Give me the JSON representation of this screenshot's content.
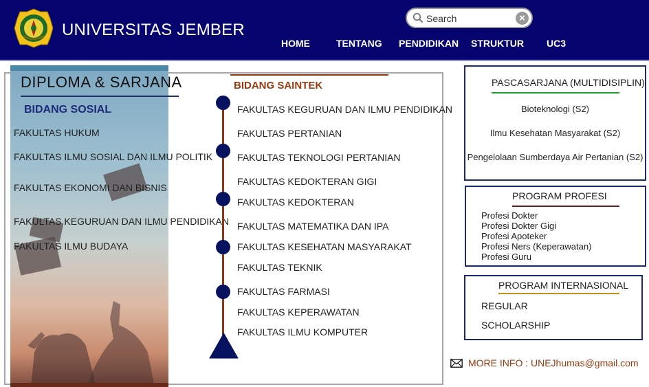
{
  "header": {
    "brand": "UNIVERSITAS JEMBER",
    "logo_text": "UNIVERSITAS JEMBER",
    "search_placeholder": "Search",
    "nav": [
      "HOME",
      "TENTANG",
      "PENDIDIKAN",
      "STRUKTUR",
      "UC3"
    ],
    "bg_color": "#05036e"
  },
  "diploma": {
    "title": "DIPLOMA & SARJANA",
    "sosial_heading": "BIDANG SOSIAL",
    "sosial_items": [
      "FAKULTAS HUKUM",
      "FAKULTAS ILMU SOSIAL DAN ILMU POLITIK",
      "FAKULTAS EKONOMI DAN BISNIS",
      "FAKULTAS KEGURUAN DAN ILMU PENDIDIKAN",
      "FAKULTAS ILMU BUDAYA"
    ],
    "saintek_heading": "BIDANG SAINTEK",
    "saintek_items": [
      "FAKULTAS KEGURUAN DAN ILMU PENDIDIKAN",
      "FAKULTAS PERTANIAN",
      "FAKULTAS TEKNOLOGI PERTANIAN",
      "FAKULTAS KEDOKTERAN GIGI",
      "FAKULTAS KEDOKTERAN",
      "FAKULTAS MATEMATIKA DAN IPA",
      "FAKULTAS KESEHATAN MASYARAKAT",
      "FAKULTAS TEKNIK",
      "FAKULTAS FARMASI",
      "FAKULTAS KEPERAWATAN",
      "FAKULTAS ILMU KOMPUTER"
    ]
  },
  "pascasarjana": {
    "heading": "PASCASARJANA (MULTIDISIPLIN)",
    "items": [
      "Bioteknologi (S2)",
      "Ilmu Kesehatan Masyarakat (S2)",
      "Pengelolaan Sumberdaya Air Pertanian (S2)"
    ],
    "accent": "#1a9a2a"
  },
  "profesi": {
    "heading": "PROGRAM PROFESI",
    "items": [
      "Profesi Dokter",
      "Profesi Dokter Gigi",
      "Profesi Apoteker",
      "Profesi Ners (Keperawatan)",
      "Profesi Guru"
    ],
    "accent": "#6a1a1a"
  },
  "internasional": {
    "heading": "PROGRAM INTERNASIONAL",
    "items": [
      "REGULAR",
      "SCHOLARSHIP"
    ],
    "accent": "#c89018"
  },
  "more_info": {
    "label": "MORE INFO : UNEJhumas@gmail.com",
    "icon": "envelope-icon",
    "color": "#9a3a10"
  }
}
